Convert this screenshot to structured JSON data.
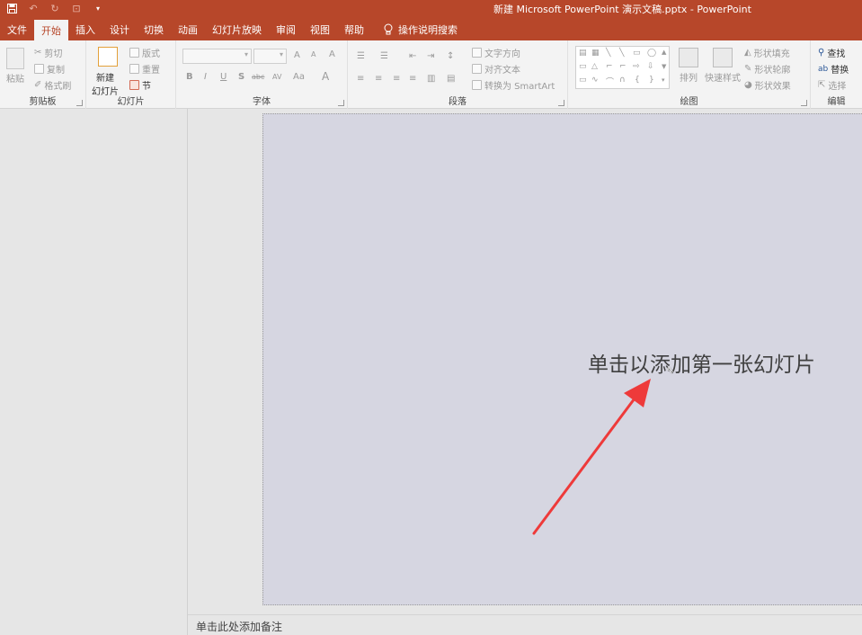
{
  "titlebar": {
    "title": "新建 Microsoft PowerPoint 演示文稿.pptx  -  PowerPoint"
  },
  "tabs": [
    "文件",
    "开始",
    "插入",
    "设计",
    "切换",
    "动画",
    "幻灯片放映",
    "审阅",
    "视图",
    "帮助"
  ],
  "active_tab": "开始",
  "tell_me": "操作说明搜索",
  "ribbon": {
    "clipboard": {
      "label": "剪贴板",
      "paste": "粘贴",
      "cut": "剪切",
      "copy": "复制",
      "format_painter": "格式刷"
    },
    "slides": {
      "label": "幻灯片",
      "new_slide_1": "新建",
      "new_slide_2": "幻灯片",
      "layout": "版式",
      "reset": "重置",
      "section": "节"
    },
    "font": {
      "label": "字体",
      "bold": "B",
      "italic": "I",
      "underline": "U",
      "shadow": "S",
      "strike": "abc",
      "spacing": "AV",
      "case": "Aa",
      "grow": "A",
      "shrink": "A",
      "clear": "A",
      "color": "A"
    },
    "paragraph": {
      "label": "段落",
      "text_direction": "文字方向",
      "align_text": "对齐文本",
      "smartart": "转换为 SmartArt"
    },
    "drawing": {
      "label": "绘图",
      "arrange": "排列",
      "quick_styles": "快速样式",
      "fill": "形状填充",
      "outline": "形状轮廓",
      "effects": "形状效果"
    },
    "editing": {
      "label": "编辑",
      "find": "查找",
      "replace": "替换",
      "select": "选择"
    }
  },
  "slide": {
    "placeholder": "单击以添加第一张幻灯片"
  },
  "notes": {
    "placeholder": "单击此处添加备注"
  },
  "colors": {
    "accent": "#b7472a",
    "annotation_arrow": "#ee3a3a"
  }
}
